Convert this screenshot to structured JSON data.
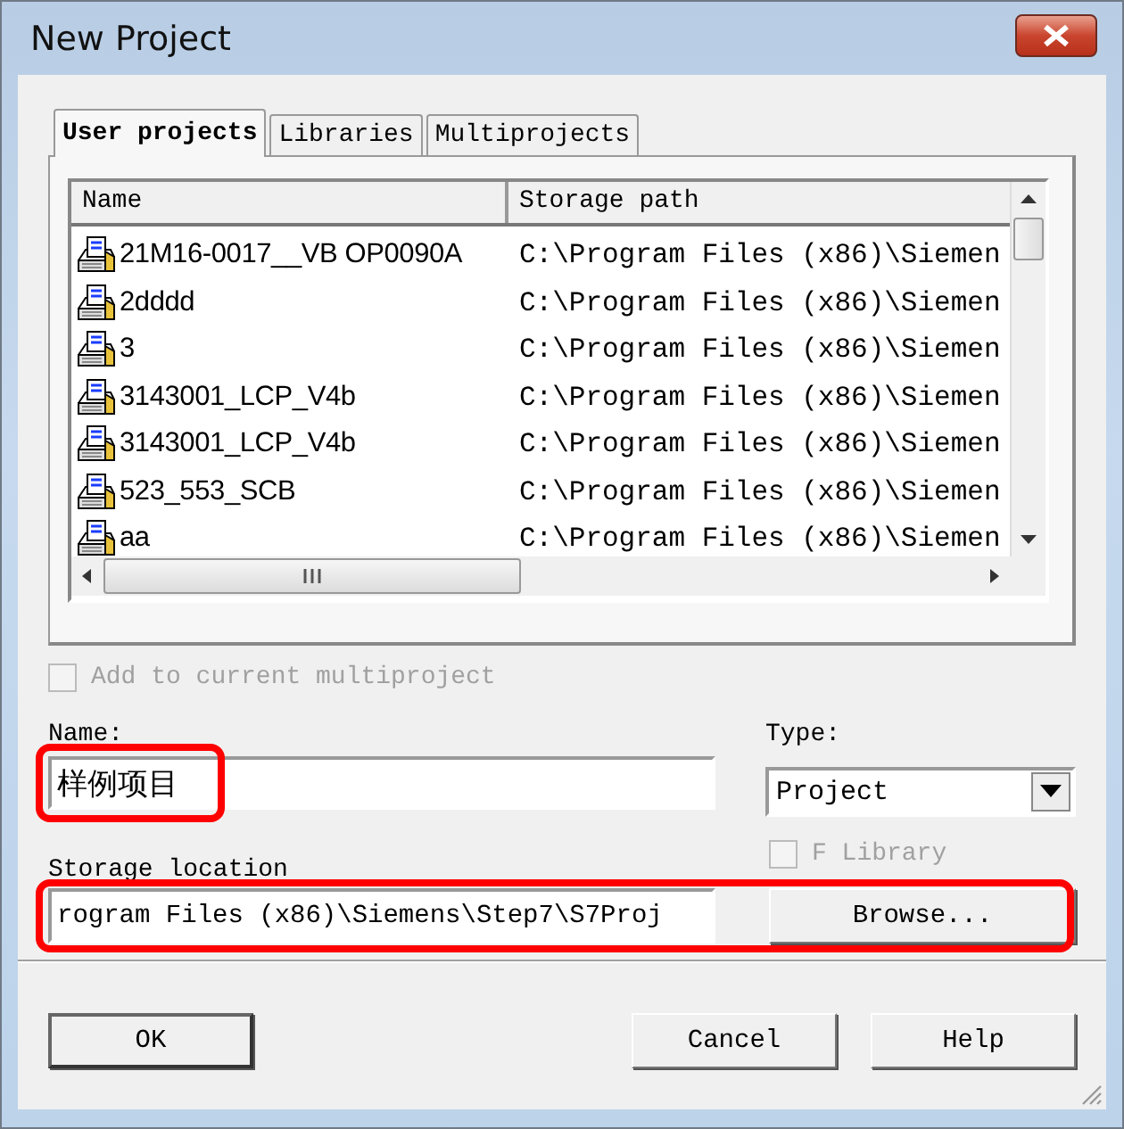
{
  "window": {
    "title": "New Project"
  },
  "tabs": [
    {
      "label": "User projects",
      "selected": true
    },
    {
      "label": "Libraries",
      "selected": false
    },
    {
      "label": "Multiprojects",
      "selected": false
    }
  ],
  "table": {
    "columns": [
      "Name",
      "Storage path"
    ],
    "rows": [
      {
        "name": "21M16-0017__VB OP0090A",
        "path": "C:\\Program Files (x86)\\Siemen"
      },
      {
        "name": "2dddd",
        "path": "C:\\Program Files (x86)\\Siemen"
      },
      {
        "name": "3",
        "path": "C:\\Program Files (x86)\\Siemen"
      },
      {
        "name": "3143001_LCP_V4b",
        "path": "C:\\Program Files (x86)\\Siemen"
      },
      {
        "name": "3143001_LCP_V4b",
        "path": "C:\\Program Files (x86)\\Siemen"
      },
      {
        "name": "523_553_SCB",
        "path": "C:\\Program Files (x86)\\Siemen"
      },
      {
        "name": "aa",
        "path": "C:\\Program Files (x86)\\Siemen"
      }
    ]
  },
  "add_to_multiproject": {
    "label": "Add to current multiproject",
    "checked": false,
    "disabled": true
  },
  "name_field": {
    "label": "Name:",
    "value": "样例项目",
    "highlighted": true
  },
  "type_field": {
    "label": "Type:",
    "value": "Project"
  },
  "f_library": {
    "label": "F Library",
    "checked": false,
    "disabled": true
  },
  "storage": {
    "label": "Storage location",
    "value": "rogram Files (x86)\\Siemens\\Step7\\S7Proj",
    "browse": "Browse...",
    "highlighted": true
  },
  "buttons": [
    {
      "label": "OK",
      "default": true
    },
    {
      "label": "Cancel",
      "default": false
    },
    {
      "label": "Help",
      "default": false
    }
  ]
}
